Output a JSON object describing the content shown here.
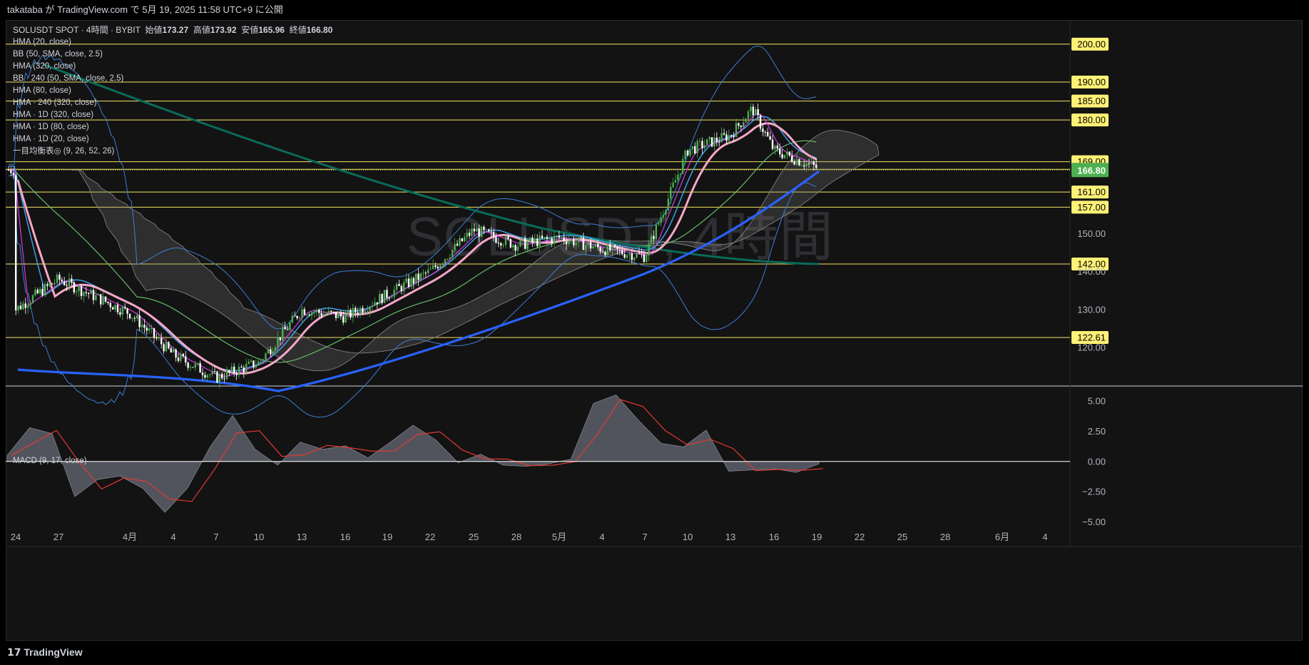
{
  "header": {
    "published": "takataba が TradingView.com で 5月 19, 2025 11:58 UTC+9 に公開"
  },
  "symbol": {
    "name": "SOLUSDT SPOT",
    "interval": "4時間",
    "exchange": "BYBIT",
    "open_label": "始値",
    "open": "173.27",
    "high_label": "高値",
    "high": "173.92",
    "low_label": "安値",
    "low": "165.96",
    "close_label": "終値",
    "close": "166.80"
  },
  "indicators": [
    "HMA (20, close)",
    "BB (50, SMA, close, 2.5)",
    "HMA (320, close)",
    "BB · 240 (50, SMA, close, 2.5)",
    "HMA (80, close)",
    "HMA · 240 (320, close)",
    "HMA · 1D (320, close)",
    "HMA · 1D (80, close)",
    "HMA · 1D (20, close)",
    "一目均衡表◎ (9, 26, 52, 26)"
  ],
  "macd_label": "MACD (9, 17, close)",
  "watermark": "SOLUSDT, 4時間",
  "brand": "TradingView",
  "chart_data": [
    {
      "type": "candlestick",
      "title": "SOLUSDT SPOT · 4時間 · BYBIT",
      "ylim": [
        110,
        206
      ],
      "x_ticks": [
        "24",
        "27",
        "4月",
        "4",
        "7",
        "10",
        "13",
        "16",
        "19",
        "22",
        "25",
        "28",
        "5月",
        "4",
        "7",
        "10",
        "13",
        "16",
        "19",
        "22",
        "25",
        "28",
        "6月",
        "4"
      ],
      "y_ticks": [
        "200.00",
        "190.00",
        "185.00",
        "180.00",
        "169.00",
        "167.00",
        "161.00",
        "157.00",
        "150.00",
        "142.00",
        "140.00",
        "130.00",
        "122.61",
        "120.00"
      ],
      "horizontal_levels": [
        200.0,
        190.0,
        185.0,
        180.0,
        169.0,
        167.0,
        161.0,
        157.0,
        142.0,
        122.61
      ],
      "current_price": 166.8,
      "price_path": [
        {
          "x": "24",
          "y": 130
        },
        {
          "x": "27",
          "y": 138
        },
        {
          "x": "4月",
          "y": 129
        },
        {
          "x": "4",
          "y": 118
        },
        {
          "x": "7",
          "y": 112
        },
        {
          "x": "10",
          "y": 116
        },
        {
          "x": "13",
          "y": 130
        },
        {
          "x": "16",
          "y": 128
        },
        {
          "x": "19",
          "y": 134
        },
        {
          "x": "22",
          "y": 140
        },
        {
          "x": "25",
          "y": 151
        },
        {
          "x": "28",
          "y": 147
        },
        {
          "x": "5月",
          "y": 149
        },
        {
          "x": "4",
          "y": 146
        },
        {
          "x": "7",
          "y": 144
        },
        {
          "x": "10",
          "y": 172
        },
        {
          "x": "13",
          "y": 176
        },
        {
          "x": "14",
          "y": 183
        },
        {
          "x": "16",
          "y": 172
        },
        {
          "x": "18",
          "y": 166
        },
        {
          "x": "19",
          "y": 166.8
        }
      ],
      "colors": {
        "up": "#4caf50",
        "down": "#ffffff",
        "level": "#f5e663",
        "hma20": "#f5a7c7",
        "hma80_blue": "#2962ff",
        "bb": "#3d7fd6",
        "hma320": "#0a6b5a",
        "price_tag": "#4caf50"
      }
    },
    {
      "type": "area",
      "title": "MACD (9, 17, close)",
      "ylim": [
        -5.2,
        6.0
      ],
      "y_ticks": [
        "5.00",
        "2.50",
        "0.00",
        "−2.50",
        "−5.00"
      ],
      "series": [
        {
          "values": [
            0.5,
            2.8,
            2.3,
            -2.9,
            -1.5,
            -1.2,
            -2.2,
            -4.2,
            -2.2,
            1.2,
            3.8,
            1.0,
            -0.3,
            1.6,
            1.0,
            1.3,
            0.3,
            1.6,
            3.0,
            1.8,
            -0.1,
            0.6,
            -0.3,
            -0.4,
            -0.2,
            0.2,
            4.8,
            5.5,
            3.4,
            1.5,
            1.2,
            2.6,
            -0.8,
            -0.7,
            -0.6,
            -0.9,
            -0.2
          ]
        }
      ],
      "colors": {
        "histogram": "#5d606b",
        "signal": "#e53935",
        "zero": "#ffffff"
      }
    }
  ]
}
